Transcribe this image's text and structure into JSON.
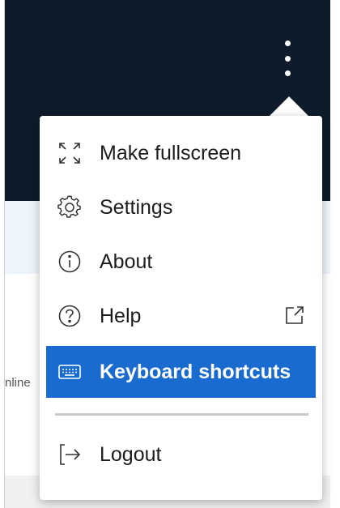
{
  "side_text": "nline",
  "menu": {
    "items": [
      {
        "label": "Make fullscreen",
        "icon": "fullscreen-icon"
      },
      {
        "label": "Settings",
        "icon": "gear-icon"
      },
      {
        "label": "About",
        "icon": "info-icon"
      },
      {
        "label": "Help",
        "icon": "help-icon",
        "trailing_icon": "external-link-icon"
      },
      {
        "label": "Keyboard shortcuts",
        "icon": "keyboard-icon",
        "active": true
      },
      {
        "label": "Logout",
        "icon": "logout-icon"
      }
    ]
  },
  "colors": {
    "topbar": "#0d1b2a",
    "accent": "#1a6bd0"
  }
}
